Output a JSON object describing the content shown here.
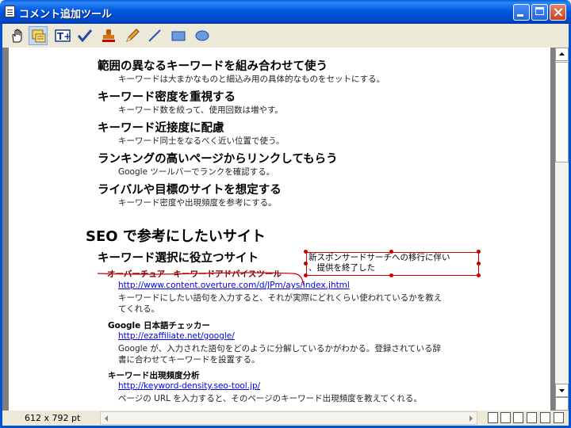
{
  "window": {
    "title": "コメント追加ツール"
  },
  "toolbar": {
    "tools": [
      "hand-tool",
      "note-tool",
      "text-box-tool",
      "check-mark-tool",
      "stamp-tool",
      "pencil-tool",
      "line-tool",
      "rectangle-tool",
      "ellipse-tool"
    ],
    "selected": "note-tool"
  },
  "document": {
    "sections": [
      {
        "heading": "範囲の異なるキーワードを組み合わせて使う",
        "text": "キーワードは大まかなものと細込み用の具体的なものをセットにする。"
      },
      {
        "heading": "キーワード密度を重視する",
        "text": "キーワード数を絞って、使用回数は増やす。"
      },
      {
        "heading": "キーワード近接度に配慮",
        "text": "キーワード同士をなるべく近い位置で使う。"
      },
      {
        "heading": "ランキングの高いページからリンクしてもらう",
        "text": "Google ツールバーでランクを確認する。"
      },
      {
        "heading": "ライバルや目標のサイトを想定する",
        "text": "キーワード密度や出現頻度を参考にする。"
      }
    ],
    "main_heading": "SEO で参考にしたいサイト",
    "subheading": "キーワード選択に役立つサイト",
    "sites": [
      {
        "name": "オーバーチュア　キーワードアドバイスツール",
        "url": "http://www.content.overture.com/d/JPm/ays/index.jhtml",
        "desc1": "キーワードにしたい語句を入力すると、それが実際にどれくらい使われているかを教え",
        "desc2": "てくれる。"
      },
      {
        "name": "Google 日本語チェッカー",
        "url": "http://ezaffiliate.net/google/",
        "desc1": "Google が、入力された語句をどのように分解しているかがわかる。登録されている辞",
        "desc2": "書に合わせてキーワードを設置する。"
      },
      {
        "name": "キーワード出現頻度分析",
        "url": "http://keyword-density.seo-tool.jp/",
        "desc1": "ページの URL を入力すると、そのページのキーワード出現頻度を教えてくれる。",
        "desc2": ""
      }
    ],
    "annotation": {
      "line1": "新スポンサードサーチへの移行に伴い",
      "line2": "、提供を終了した"
    }
  },
  "status": {
    "page_size": "612 x 792 pt"
  },
  "colors": {
    "titlebar": "#0058e0",
    "annotation": "#cc0000",
    "link": "#0000ee"
  }
}
